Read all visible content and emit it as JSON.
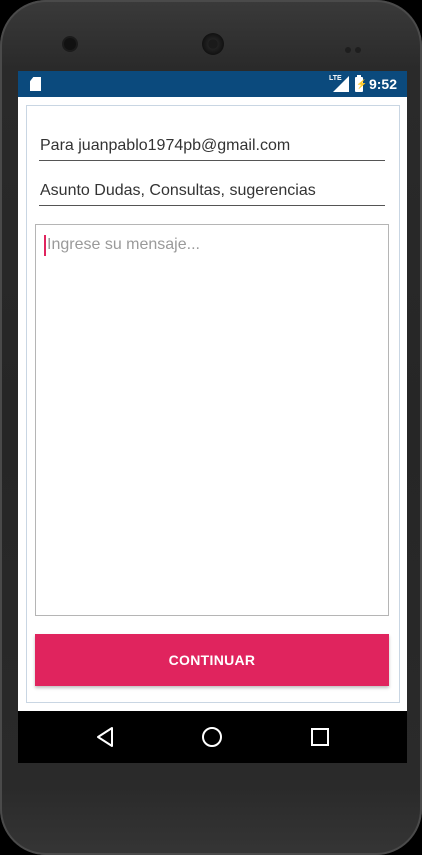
{
  "status_bar": {
    "network_label": "LTE",
    "time": "9:52",
    "icons": [
      "sd-card-icon",
      "lte-signal-icon",
      "battery-charging-icon"
    ]
  },
  "form": {
    "to_value": "Para juanpablo1974pb@gmail.com",
    "subject_value": "Asunto Dudas, Consultas, sugerencias",
    "message_placeholder": "Ingrese su mensaje...",
    "continue_label": "CONTINUAR"
  },
  "nav_bar": {
    "icons": [
      "back-icon",
      "home-icon",
      "recents-icon"
    ]
  },
  "colors": {
    "status_bar": "#0b4a7d",
    "accent": "#e0245e",
    "nav_bar": "#000000"
  }
}
